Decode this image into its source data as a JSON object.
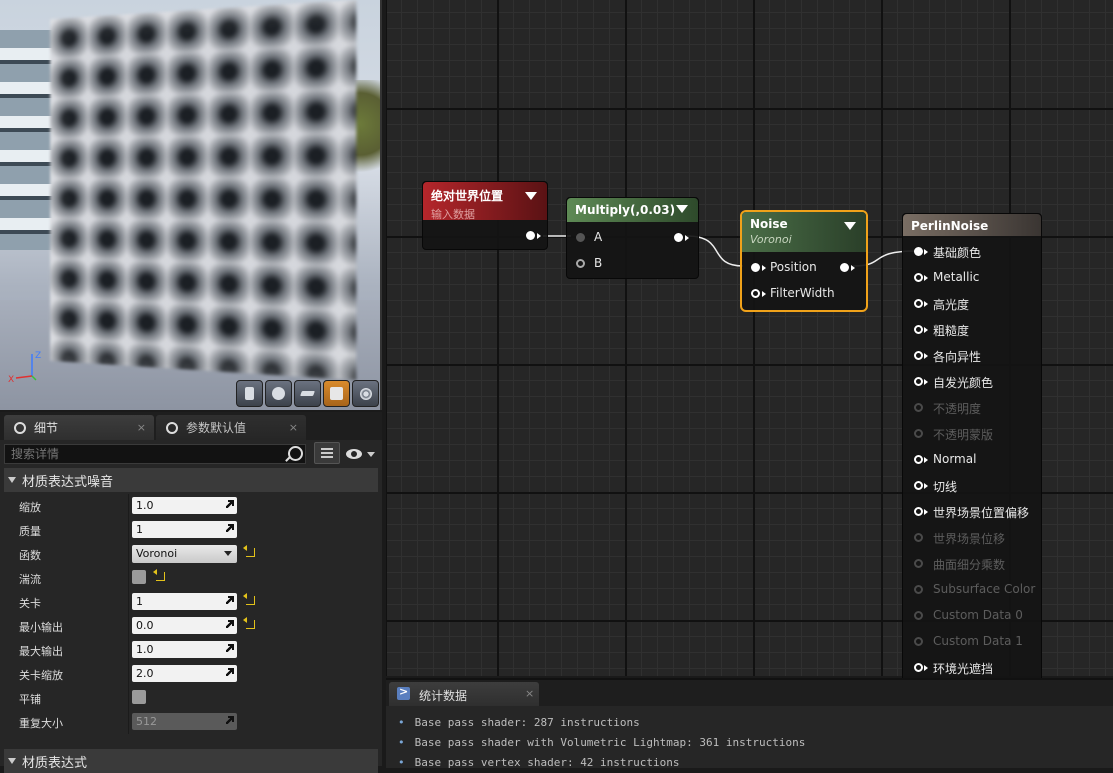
{
  "details": {
    "tabs": [
      {
        "label": "细节",
        "close": "×"
      },
      {
        "label": "参数默认值",
        "close": "×"
      }
    ],
    "search_placeholder": "搜索详情",
    "section_noise": "材质表达式噪音",
    "section_expression": "材质表达式",
    "properties": [
      {
        "label": "缩放",
        "type": "number",
        "value": "1.0"
      },
      {
        "label": "质量",
        "type": "number",
        "value": "1"
      },
      {
        "label": "函数",
        "type": "dropdown",
        "value": "Voronoi",
        "reset": true
      },
      {
        "label": "湍流",
        "type": "checkbox",
        "checked": false,
        "reset": true
      },
      {
        "label": "关卡",
        "type": "number",
        "value": "1",
        "reset": true
      },
      {
        "label": "最小输出",
        "type": "number",
        "value": "0.0",
        "reset": true
      },
      {
        "label": "最大输出",
        "type": "number",
        "value": "1.0"
      },
      {
        "label": "关卡缩放",
        "type": "number",
        "value": "2.0"
      },
      {
        "label": "平铺",
        "type": "checkbox",
        "checked": false
      },
      {
        "label": "重复大小",
        "type": "number",
        "value": "512",
        "disabled": true
      }
    ]
  },
  "graph": {
    "nodes": {
      "absolute_world_position": {
        "title": "绝对世界位置",
        "subtitle": "输入数据"
      },
      "multiply": {
        "title": "Multiply(,0.03)",
        "pins": [
          "A",
          "B"
        ]
      },
      "noise": {
        "title": "Noise",
        "subtitle": "Voronoi",
        "pins": [
          "Position",
          "FilterWidth"
        ]
      },
      "perlin": {
        "title": "PerlinNoise",
        "pins": [
          {
            "label": "基础颜色",
            "enabled": true,
            "connected": true
          },
          {
            "label": "Metallic",
            "enabled": true
          },
          {
            "label": "高光度",
            "enabled": true
          },
          {
            "label": "粗糙度",
            "enabled": true
          },
          {
            "label": "各向异性",
            "enabled": true
          },
          {
            "label": "自发光颜色",
            "enabled": true
          },
          {
            "label": "不透明度",
            "enabled": false
          },
          {
            "label": "不透明蒙版",
            "enabled": false
          },
          {
            "label": "Normal",
            "enabled": true
          },
          {
            "label": "切线",
            "enabled": true
          },
          {
            "label": "世界场景位置偏移",
            "enabled": true
          },
          {
            "label": "世界场景位移",
            "enabled": false
          },
          {
            "label": "曲面细分乘数",
            "enabled": false
          },
          {
            "label": "Subsurface Color",
            "enabled": false
          },
          {
            "label": "Custom Data 0",
            "enabled": false
          },
          {
            "label": "Custom Data 1",
            "enabled": false
          },
          {
            "label": "环境光遮挡",
            "enabled": true
          }
        ]
      }
    }
  },
  "stats": {
    "tab_label": "统计数据",
    "close": "×",
    "lines": [
      "Base pass shader: 287 instructions",
      "Base pass shader with Volumetric Lightmap: 361 instructions",
      "Base pass vertex shader: 42 instructions"
    ]
  },
  "colors": {
    "accent_selected": "#f0a21a",
    "input_node": "#b5262b",
    "math_node": "#5e8a55",
    "result_node": "#7a6e64"
  }
}
